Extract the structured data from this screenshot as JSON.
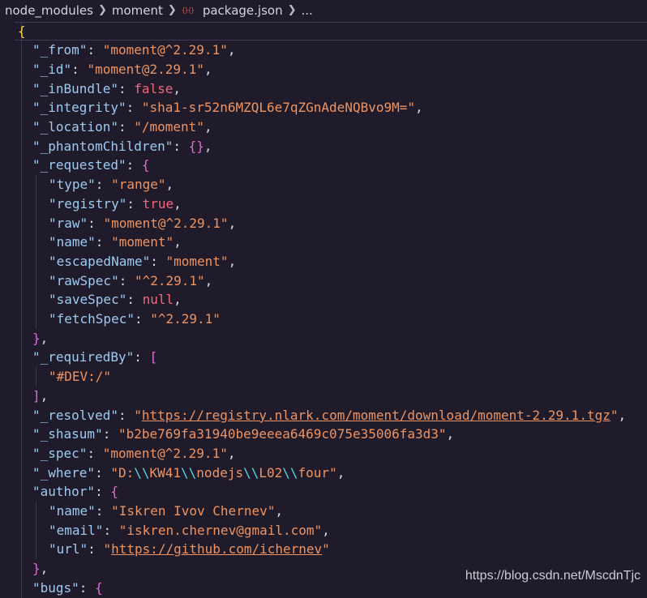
{
  "breadcrumb": {
    "items": [
      "node_modules",
      "moment",
      "package.json",
      "..."
    ],
    "file_icon": "json-file-icon"
  },
  "code": {
    "language": "json",
    "lines": [
      [
        [
          "br1",
          "{"
        ]
      ],
      [
        [
          "k",
          "\"_from\""
        ],
        [
          "p",
          ": "
        ],
        [
          "s",
          "\"moment@^2.29.1\""
        ],
        [
          "p",
          ","
        ]
      ],
      [
        [
          "k",
          "\"_id\""
        ],
        [
          "p",
          ": "
        ],
        [
          "s",
          "\"moment@2.29.1\""
        ],
        [
          "p",
          ","
        ]
      ],
      [
        [
          "k",
          "\"_inBundle\""
        ],
        [
          "p",
          ": "
        ],
        [
          "b",
          "false"
        ],
        [
          "p",
          ","
        ]
      ],
      [
        [
          "k",
          "\"_integrity\""
        ],
        [
          "p",
          ": "
        ],
        [
          "s",
          "\"sha1-sr52n6MZQL6e7qZGnAdeNQBvo9M=\""
        ],
        [
          "p",
          ","
        ]
      ],
      [
        [
          "k",
          "\"_location\""
        ],
        [
          "p",
          ": "
        ],
        [
          "s",
          "\"/moment\""
        ],
        [
          "p",
          ","
        ]
      ],
      [
        [
          "k",
          "\"_phantomChildren\""
        ],
        [
          "p",
          ": "
        ],
        [
          "br2",
          "{}"
        ],
        [
          "p",
          ","
        ]
      ],
      [
        [
          "k",
          "\"_requested\""
        ],
        [
          "p",
          ": "
        ],
        [
          "br2",
          "{"
        ]
      ],
      [
        [
          "k",
          "\"type\""
        ],
        [
          "p",
          ": "
        ],
        [
          "s",
          "\"range\""
        ],
        [
          "p",
          ","
        ]
      ],
      [
        [
          "k",
          "\"registry\""
        ],
        [
          "p",
          ": "
        ],
        [
          "b",
          "true"
        ],
        [
          "p",
          ","
        ]
      ],
      [
        [
          "k",
          "\"raw\""
        ],
        [
          "p",
          ": "
        ],
        [
          "s",
          "\"moment@^2.29.1\""
        ],
        [
          "p",
          ","
        ]
      ],
      [
        [
          "k",
          "\"name\""
        ],
        [
          "p",
          ": "
        ],
        [
          "s",
          "\"moment\""
        ],
        [
          "p",
          ","
        ]
      ],
      [
        [
          "k",
          "\"escapedName\""
        ],
        [
          "p",
          ": "
        ],
        [
          "s",
          "\"moment\""
        ],
        [
          "p",
          ","
        ]
      ],
      [
        [
          "k",
          "\"rawSpec\""
        ],
        [
          "p",
          ": "
        ],
        [
          "s",
          "\"^2.29.1\""
        ],
        [
          "p",
          ","
        ]
      ],
      [
        [
          "k",
          "\"saveSpec\""
        ],
        [
          "p",
          ": "
        ],
        [
          "n",
          "null"
        ],
        [
          "p",
          ","
        ]
      ],
      [
        [
          "k",
          "\"fetchSpec\""
        ],
        [
          "p",
          ": "
        ],
        [
          "s",
          "\"^2.29.1\""
        ]
      ],
      [
        [
          "br2",
          "}"
        ],
        [
          "p",
          ","
        ]
      ],
      [
        [
          "k",
          "\"_requiredBy\""
        ],
        [
          "p",
          ": "
        ],
        [
          "br2",
          "["
        ]
      ],
      [
        [
          "s",
          "\"#DEV:/\""
        ]
      ],
      [
        [
          "br2",
          "]"
        ],
        [
          "p",
          ","
        ]
      ],
      [
        [
          "k",
          "\"_resolved\""
        ],
        [
          "p",
          ": "
        ],
        [
          "s",
          "\""
        ],
        [
          "s link",
          "https://registry.nlark.com/moment/download/moment-2.29.1.tgz"
        ],
        [
          "s",
          "\""
        ],
        [
          "p",
          ","
        ]
      ],
      [
        [
          "k",
          "\"_shasum\""
        ],
        [
          "p",
          ": "
        ],
        [
          "s",
          "\"b2be769fa31940be9eeea6469c075e35006fa3d3\""
        ],
        [
          "p",
          ","
        ]
      ],
      [
        [
          "k",
          "\"_spec\""
        ],
        [
          "p",
          ": "
        ],
        [
          "s",
          "\"moment@^2.29.1\""
        ],
        [
          "p",
          ","
        ]
      ],
      [
        [
          "k",
          "\"_where\""
        ],
        [
          "p",
          ": "
        ],
        [
          "s",
          "\"D:"
        ],
        [
          "esc",
          "\\\\"
        ],
        [
          "s",
          "KW41"
        ],
        [
          "esc",
          "\\\\"
        ],
        [
          "s",
          "nodejs"
        ],
        [
          "esc",
          "\\\\"
        ],
        [
          "s",
          "L02"
        ],
        [
          "esc",
          "\\\\"
        ],
        [
          "s",
          "four\""
        ],
        [
          "p",
          ","
        ]
      ],
      [
        [
          "k",
          "\"author\""
        ],
        [
          "p",
          ": "
        ],
        [
          "br2",
          "{"
        ]
      ],
      [
        [
          "k",
          "\"name\""
        ],
        [
          "p",
          ": "
        ],
        [
          "s",
          "\"Iskren Ivov Chernev\""
        ],
        [
          "p",
          ","
        ]
      ],
      [
        [
          "k",
          "\"email\""
        ],
        [
          "p",
          ": "
        ],
        [
          "s",
          "\"iskren.chernev@gmail.com\""
        ],
        [
          "p",
          ","
        ]
      ],
      [
        [
          "k",
          "\"url\""
        ],
        [
          "p",
          ": "
        ],
        [
          "s",
          "\""
        ],
        [
          "s link",
          "https://github.com/ichernev"
        ],
        [
          "s",
          "\""
        ]
      ],
      [
        [
          "br2",
          "}"
        ],
        [
          "p",
          ","
        ]
      ],
      [
        [
          "k",
          "\"bugs\""
        ],
        [
          "p",
          ": "
        ],
        [
          "br2",
          "{"
        ]
      ]
    ]
  },
  "watermark": "https://blog.csdn.net/MscdnTjc",
  "colors": {
    "background": "#1f1b2a",
    "key": "#9ecbf0",
    "string": "#ee9460",
    "literal": "#f2677b",
    "bracket_outer": "#ffd54a",
    "bracket_inner": "#e36ad6",
    "escape": "#56d6e6"
  }
}
